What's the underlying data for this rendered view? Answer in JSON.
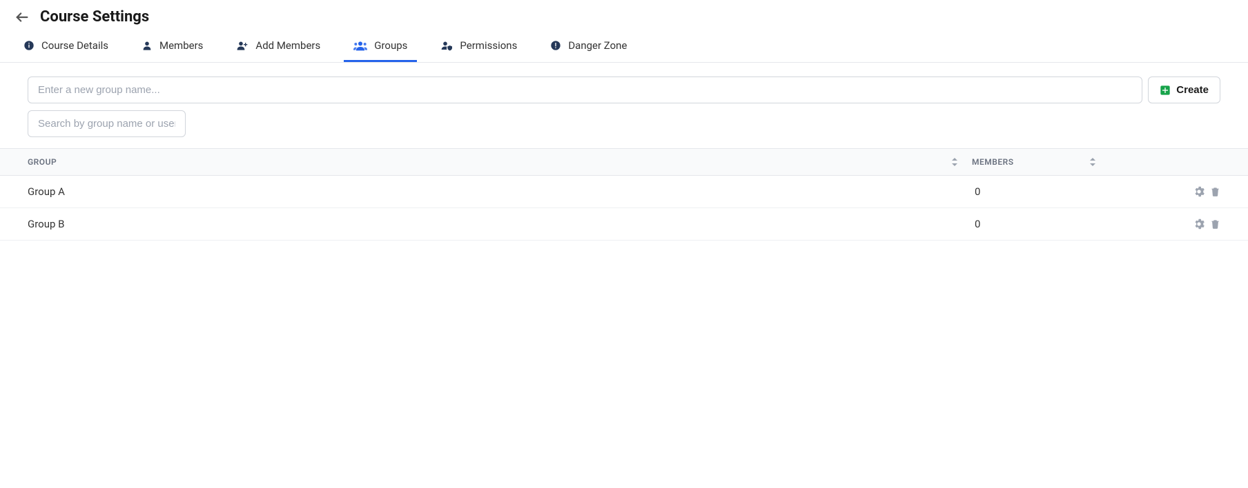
{
  "header": {
    "title": "Course Settings"
  },
  "tabs": [
    {
      "id": "course-details",
      "label": "Course Details",
      "icon": "info-icon",
      "active": false
    },
    {
      "id": "members",
      "label": "Members",
      "icon": "user-icon",
      "active": false
    },
    {
      "id": "add-members",
      "label": "Add Members",
      "icon": "user-plus-icon",
      "active": false
    },
    {
      "id": "groups",
      "label": "Groups",
      "icon": "users-icon",
      "active": true
    },
    {
      "id": "permissions",
      "label": "Permissions",
      "icon": "user-shield-icon",
      "active": false
    },
    {
      "id": "danger-zone",
      "label": "Danger Zone",
      "icon": "warning-icon",
      "active": false
    }
  ],
  "create": {
    "placeholder": "Enter a new group name...",
    "button_label": "Create"
  },
  "search": {
    "placeholder": "Search by group name or user name/username"
  },
  "table": {
    "columns": {
      "group": "GROUP",
      "members": "MEMBERS"
    },
    "rows": [
      {
        "name": "Group A",
        "members": "0"
      },
      {
        "name": "Group B",
        "members": "0"
      }
    ]
  }
}
